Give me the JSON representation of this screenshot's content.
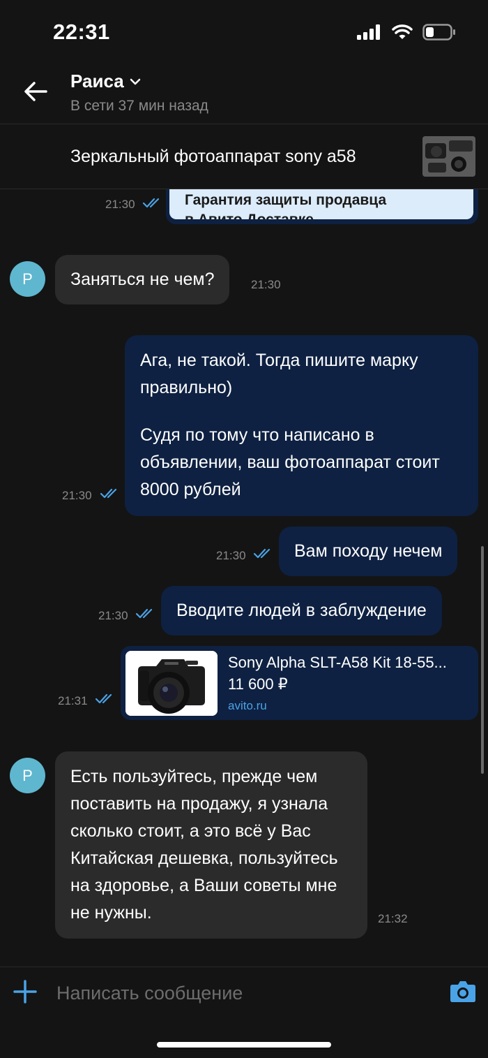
{
  "status_bar": {
    "time": "22:31"
  },
  "header": {
    "contact_name": "Раиса",
    "contact_status": "В сети 37 мин назад"
  },
  "listing": {
    "title": "Зеркальный фотоаппарат sony a58"
  },
  "messages": [
    {
      "direction": "out",
      "type": "card",
      "text_line1": "Гарантия защиты продавца",
      "text_line2": "в Авито Доставке",
      "time": "21:30",
      "read": true
    },
    {
      "direction": "in",
      "avatar_letter": "Р",
      "text": "Заняться не чем?",
      "time": "21:30"
    },
    {
      "direction": "out",
      "paragraphs": [
        "Ага, не такой. Тогда пишите марку правильно)",
        "Судя по тому что написано в объявлении, ваш фотоаппарат стоит 8000 рублей"
      ],
      "time": "21:30",
      "read": true
    },
    {
      "direction": "out",
      "text": "Вам походу нечем",
      "time": "21:30",
      "read": true
    },
    {
      "direction": "out",
      "text": "Вводите людей в заблуждение",
      "time": "21:30",
      "read": true
    },
    {
      "direction": "out",
      "type": "link",
      "title": "Sony Alpha SLT-A58 Kit 18-55...",
      "price": "11 600 ₽",
      "domain": "avito.ru",
      "time": "21:31",
      "read": true
    },
    {
      "direction": "in",
      "avatar_letter": "Р",
      "text": "Есть пользуйтесь, прежде чем поставить на продажу, я узнала сколько стоит, а это всё у Вас Китайская дешевка, пользуйтесь на здоровье, а Ваши советы мне не нужны.",
      "time": "21:32"
    }
  ],
  "composer": {
    "placeholder": "Написать сообщение"
  },
  "colors": {
    "background": "#141414",
    "incoming_bubble": "#2b2b2b",
    "outgoing_bubble": "#0e2142",
    "accent": "#4aa3e6",
    "avatar": "#5fb6cf"
  },
  "icons": [
    "back-arrow-icon",
    "chevron-down-icon",
    "double-check-icon",
    "plus-icon",
    "camera-icon",
    "signal-icon",
    "wifi-icon",
    "battery-icon"
  ]
}
